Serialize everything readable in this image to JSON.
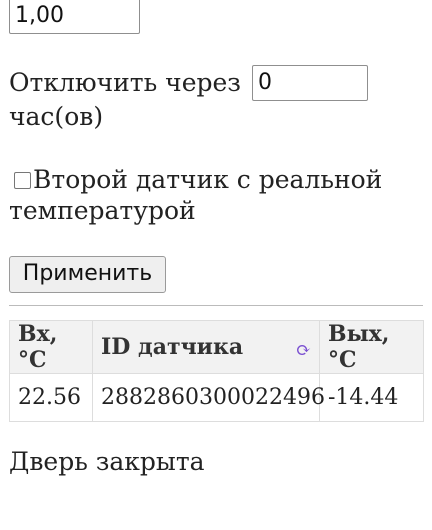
{
  "form": {
    "top_field_value": "1,00",
    "shutdown_label": "Отключить через",
    "shutdown_value": "0",
    "shutdown_unit": "час(ов)",
    "second_sensor_label": "Второй датчик с реальной",
    "second_sensor_label_line2": "температурой",
    "second_sensor_checked": false,
    "apply_button": "Применить"
  },
  "table": {
    "headers": [
      "Вх, °C",
      "ID датчика",
      "Вых, °C"
    ],
    "refresh_icon": "refresh-icon",
    "rows": [
      {
        "in": "22.56",
        "id": "2882860300022496",
        "out": "-14.44"
      }
    ]
  },
  "status": {
    "door": "Дверь закрыта"
  },
  "colors": {
    "accent": "#7a4fd1",
    "header_bg": "#f2f2f2"
  }
}
